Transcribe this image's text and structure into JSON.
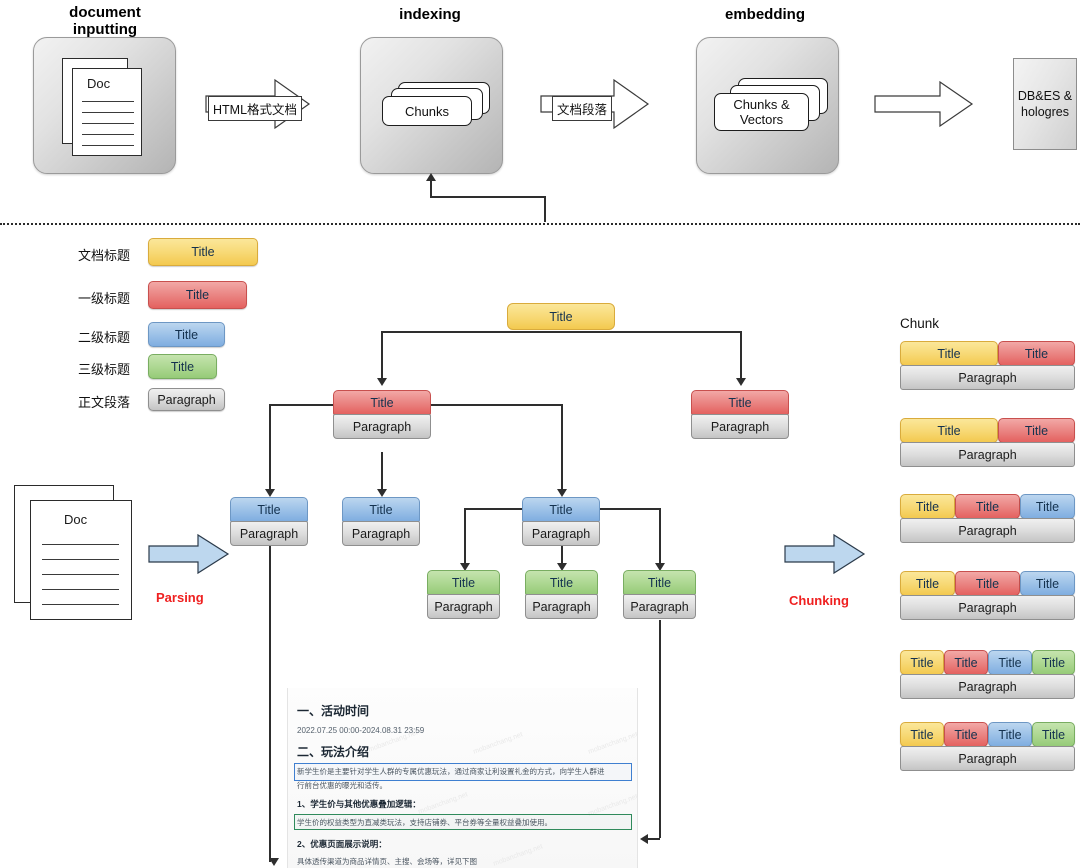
{
  "pipeline": {
    "stages": [
      {
        "title": "document\ninputting",
        "label": "document inputting"
      },
      {
        "title": "indexing",
        "label": "indexing"
      },
      {
        "title": "embedding",
        "label": "embedding"
      }
    ],
    "doc_label": "Doc",
    "chunks_label": "Chunks",
    "chunks_vectors_label": "Chunks &\nVectors",
    "arrow1_label": "HTML格式文档",
    "arrow2_label": "文档段落",
    "store_label": "DB&ES &\nhologres"
  },
  "legend": {
    "items": [
      {
        "label": "文档标题",
        "chip": "Title",
        "color": "#f7d873",
        "kind": "yellow"
      },
      {
        "label": "一级标题",
        "chip": "Title",
        "color": "#ea8583",
        "kind": "red"
      },
      {
        "label": "二级标题",
        "chip": "Title",
        "color": "#9dc2e8",
        "kind": "blue"
      },
      {
        "label": "三级标题",
        "chip": "Title",
        "color": "#aed893",
        "kind": "green"
      },
      {
        "label": "正文段落",
        "chip": "Paragraph",
        "color": "#dcdcdc",
        "kind": "gray"
      }
    ]
  },
  "source": {
    "doc_label": "Doc",
    "parsing_label": "Parsing",
    "chunking_label": "Chunking"
  },
  "tree": {
    "title_text": "Title",
    "paragraph_text": "Paragraph",
    "nodes": [
      {
        "id": "root",
        "level": 0,
        "kind": "yellow",
        "title": "Title",
        "paragraph": null
      },
      {
        "id": "h1a",
        "level": 1,
        "kind": "red",
        "title": "Title",
        "paragraph": "Paragraph"
      },
      {
        "id": "h1b",
        "level": 1,
        "kind": "red",
        "title": "Title",
        "paragraph": "Paragraph"
      },
      {
        "id": "h2a",
        "level": 2,
        "kind": "blue",
        "title": "Title",
        "paragraph": "Paragraph"
      },
      {
        "id": "h2b",
        "level": 2,
        "kind": "blue",
        "title": "Title",
        "paragraph": "Paragraph"
      },
      {
        "id": "h2c",
        "level": 2,
        "kind": "blue",
        "title": "Title",
        "paragraph": "Paragraph"
      },
      {
        "id": "h3a",
        "level": 3,
        "kind": "green",
        "title": "Title",
        "paragraph": "Paragraph"
      },
      {
        "id": "h3b",
        "level": 3,
        "kind": "green",
        "title": "Title",
        "paragraph": "Paragraph"
      },
      {
        "id": "h3c",
        "level": 3,
        "kind": "green",
        "title": "Title",
        "paragraph": "Paragraph"
      }
    ]
  },
  "chunks": {
    "header": "Chunk",
    "paragraph_label": "Paragraph",
    "items": [
      {
        "segments": [
          {
            "label": "Title",
            "kind": "yellow"
          },
          {
            "label": "Title",
            "kind": "red"
          }
        ],
        "paragraph": "Paragraph"
      },
      {
        "segments": [
          {
            "label": "Title",
            "kind": "yellow"
          },
          {
            "label": "Title",
            "kind": "red"
          }
        ],
        "paragraph": "Paragraph"
      },
      {
        "segments": [
          {
            "label": "Title",
            "kind": "yellow"
          },
          {
            "label": "Title",
            "kind": "red"
          },
          {
            "label": "Title",
            "kind": "blue"
          }
        ],
        "paragraph": "Paragraph"
      },
      {
        "segments": [
          {
            "label": "Title",
            "kind": "yellow"
          },
          {
            "label": "Title",
            "kind": "red"
          },
          {
            "label": "Title",
            "kind": "blue"
          }
        ],
        "paragraph": "Paragraph"
      },
      {
        "segments": [
          {
            "label": "Title",
            "kind": "yellow"
          },
          {
            "label": "Title",
            "kind": "red"
          },
          {
            "label": "Title",
            "kind": "blue"
          },
          {
            "label": "Title",
            "kind": "green"
          }
        ],
        "paragraph": "Paragraph"
      },
      {
        "segments": [
          {
            "label": "Title",
            "kind": "yellow"
          },
          {
            "label": "Title",
            "kind": "red"
          },
          {
            "label": "Title",
            "kind": "blue"
          },
          {
            "label": "Title",
            "kind": "green"
          }
        ],
        "paragraph": "Paragraph"
      }
    ]
  },
  "docshot": {
    "h1": "一、活动时间",
    "time_range": "2022.07.25 00:00-2024.08.31 23:59",
    "h2": "二、玩法介绍",
    "intro_line1": "新学生价是主要针对学生人群的专属优惠玩法，通过商家让利设置礼金的方式，向学生人群进",
    "intro_line2": "行前台优惠的曝光和适传。",
    "h3": "1、学生价与其他优惠叠加逻辑：",
    "body3": "学生价的权益类型为直减类玩法，支持店铺券、平台券等全量权益叠加使用。",
    "h4": "2、优惠页面展示说明：",
    "body4": "具体透传渠道为商品详情页、主搜、会场等，详见下图",
    "watermark": "mobanchang.net"
  },
  "colors": {
    "yellow": "#f7d873",
    "red": "#ea8583",
    "blue": "#9dc2e8",
    "green": "#aed893",
    "gray": "#dcdcdc",
    "accent_red_text": "#ef2020",
    "line": "#2e2e2e"
  }
}
